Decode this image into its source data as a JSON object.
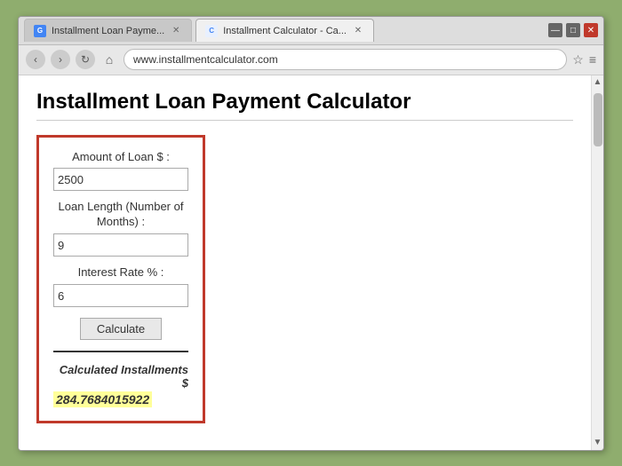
{
  "browser": {
    "tabs": [
      {
        "label": "Installment Loan Payme...",
        "active": false,
        "favicon": "G"
      },
      {
        "label": "Installment Calculator - Ca...",
        "active": true,
        "favicon": "C"
      }
    ],
    "controls": {
      "minimize": "—",
      "maximize": "□",
      "close": "✕"
    },
    "nav": {
      "back": "‹",
      "forward": "›",
      "reload": "↻",
      "home": "⌂"
    },
    "url": "www.installmentcalculator.com",
    "url_icons": {
      "star": "☆",
      "menu": "≡"
    }
  },
  "page": {
    "title": "Installment Loan Payment Calculator",
    "calculator": {
      "loan_amount_label": "Amount of Loan $ :",
      "loan_amount_value": "2500",
      "loan_length_label": "Loan Length (Number of Months) :",
      "loan_length_value": "9",
      "interest_rate_label": "Interest Rate % :",
      "interest_rate_value": "6",
      "calculate_button": "Calculate",
      "result_label": "Calculated Installments $",
      "result_value": "284.7684015922"
    }
  }
}
